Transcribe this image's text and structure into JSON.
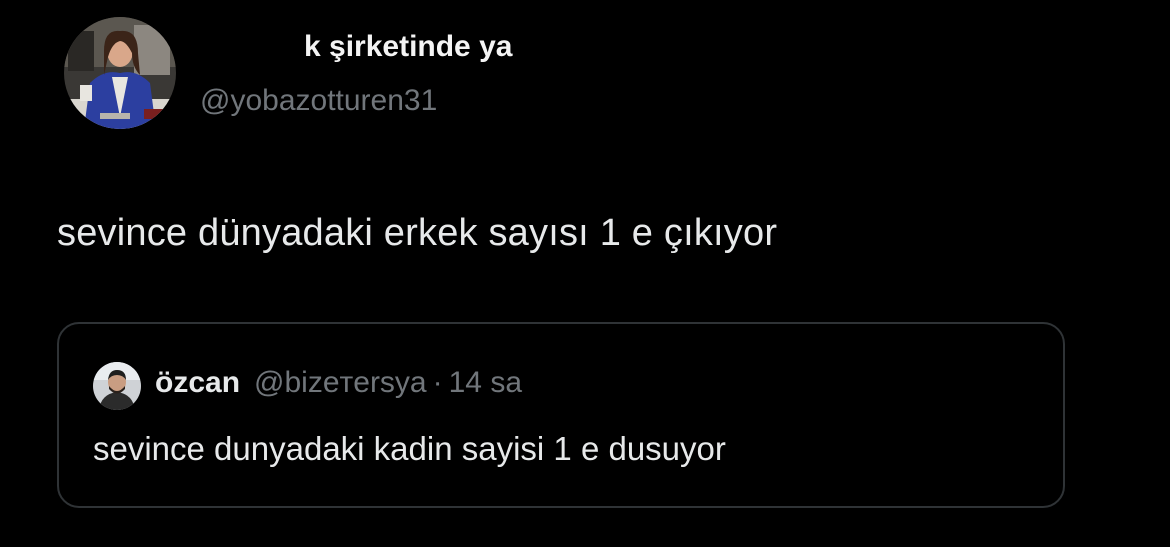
{
  "tweet": {
    "author": {
      "display_name": "k şirketinde ya",
      "handle": "@yobazotturen31",
      "avatar": "profile-photo"
    },
    "text": "sevince dünyadaki erkek sayısı 1 e çıkıyor"
  },
  "quoted_tweet": {
    "author": {
      "display_name": "özcan",
      "handle": "@bizeтersya",
      "avatar": "profile-photo"
    },
    "separator": "·",
    "time": "14 sa",
    "text": "sevince dunyadaki kadin sayisi 1 e dusuyor"
  },
  "colors": {
    "background": "#000000",
    "primary_text": "#e7e9ea",
    "secondary_text": "#71767b",
    "card_border": "#2f3336"
  }
}
